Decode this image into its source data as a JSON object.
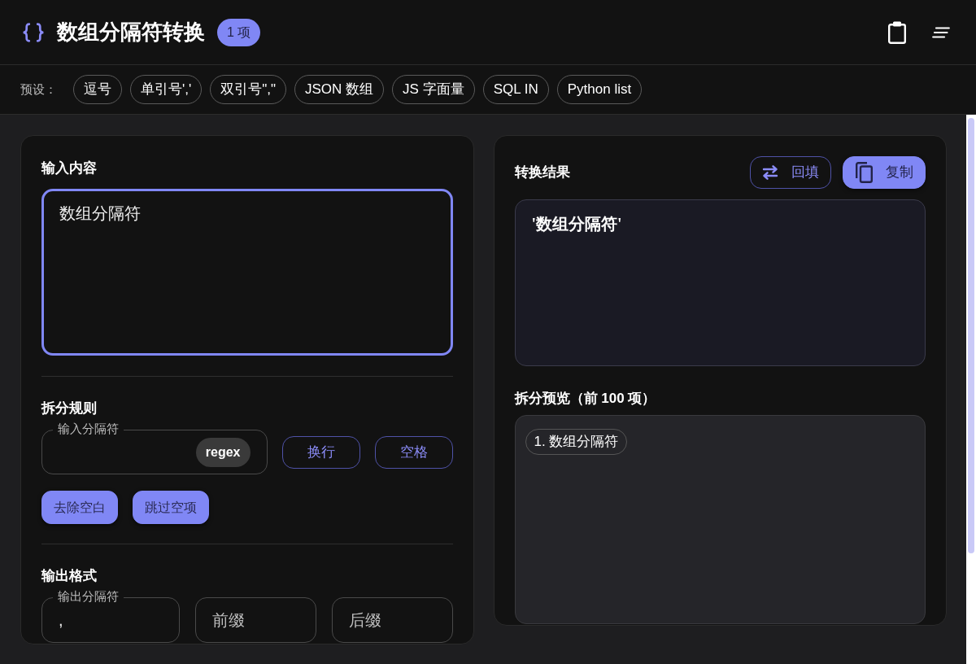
{
  "header": {
    "title": "数组分隔符转换",
    "count_badge": "1 项"
  },
  "presets": {
    "label": "预设：",
    "items": [
      {
        "label": "逗号"
      },
      {
        "label": "单引号','"
      },
      {
        "label": "双引号\",\""
      },
      {
        "label": "JSON 数组"
      },
      {
        "label": "JS 字面量"
      },
      {
        "label": "SQL IN"
      },
      {
        "label": "Python list"
      }
    ]
  },
  "input": {
    "title": "输入内容",
    "value": "数组分隔符",
    "focused": true
  },
  "split_rules": {
    "title": "拆分规则",
    "delimiter": {
      "label": "输入分隔符"
    },
    "regex": {
      "label": "regex",
      "on": false
    },
    "quick_buttons": [
      {
        "label": "换行"
      },
      {
        "label": "空格"
      }
    ],
    "toggles": [
      {
        "label": "去除空白",
        "on": true
      },
      {
        "label": "跳过空项",
        "on": true
      }
    ]
  },
  "output_format": {
    "title": "输出格式",
    "delimiter": {
      "label": "输出分隔符",
      "value": ","
    },
    "prefix": {
      "placeholder": "前缀"
    },
    "suffix": {
      "placeholder": "后缀"
    }
  },
  "result": {
    "title": "转换结果",
    "buttons": [
      {
        "kind": "outline",
        "label": "回填"
      },
      {
        "kind": "filled",
        "label": "复制"
      }
    ],
    "output": "'数组分隔符'"
  },
  "preview": {
    "title": "拆分预览（前 100 项）",
    "items": [
      "1. 数组分隔符"
    ]
  }
}
